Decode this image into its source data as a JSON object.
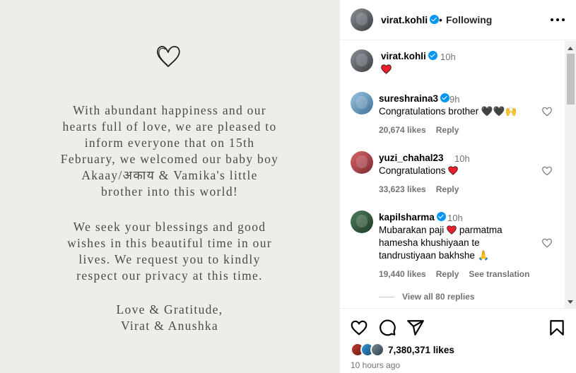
{
  "post": {
    "letter": {
      "paragraph1": [
        "With abundant happiness and our",
        "hearts full of love, we are pleased to",
        "inform everyone that on 15th",
        "February, we welcomed our baby boy",
        "Akaay/अकाय & Vamika's little",
        "brother into this world!"
      ],
      "paragraph2": [
        "We seek your blessings and good",
        "wishes in this beautiful time in our",
        "lives. We request you to kindly",
        "respect our privacy at this time."
      ],
      "signoff": [
        "Love & Gratitude,",
        "Virat & Anushka"
      ]
    }
  },
  "header": {
    "username": "virat.kohli",
    "separator": "•",
    "following_label": "Following",
    "more_icon": "more-horizontal-icon"
  },
  "comments": [
    {
      "username": "virat.kohli",
      "time": "10h",
      "text": "",
      "emoji": "red-heart",
      "likes": "",
      "reply": "",
      "is_caption": true
    },
    {
      "username": "sureshraina3",
      "time": "9h",
      "text": "Congratulations brother 🖤🖤🙌",
      "likes": "20,674 likes",
      "reply": "Reply"
    },
    {
      "username": "yuzi_chahal23",
      "time": "10h",
      "text": "Congratulations",
      "emoji": "red-heart",
      "likes": "33,623 likes",
      "reply": "Reply"
    },
    {
      "username": "kapilsharma",
      "time": "10h",
      "text_line1": "Mubarakan paji",
      "text_line1b": "parmatma",
      "text_line2": "hamesha khushiyaan te",
      "text_line3": "tandrustiyaan bakhshe 🙏",
      "likes": "19,440 likes",
      "reply": "Reply",
      "translate": "See translation"
    }
  ],
  "view_replies": "View all 80 replies",
  "actions": {
    "icons": [
      "heart-outline-icon",
      "comment-icon",
      "share-icon",
      "bookmark-icon"
    ],
    "likes": "7,380,371 likes",
    "time": "10 hours ago"
  },
  "colors": {
    "verified": "#0095f6",
    "muted": "#737373",
    "red_heart": "#ed1e2c",
    "letter_bg": "#eef0ea"
  }
}
